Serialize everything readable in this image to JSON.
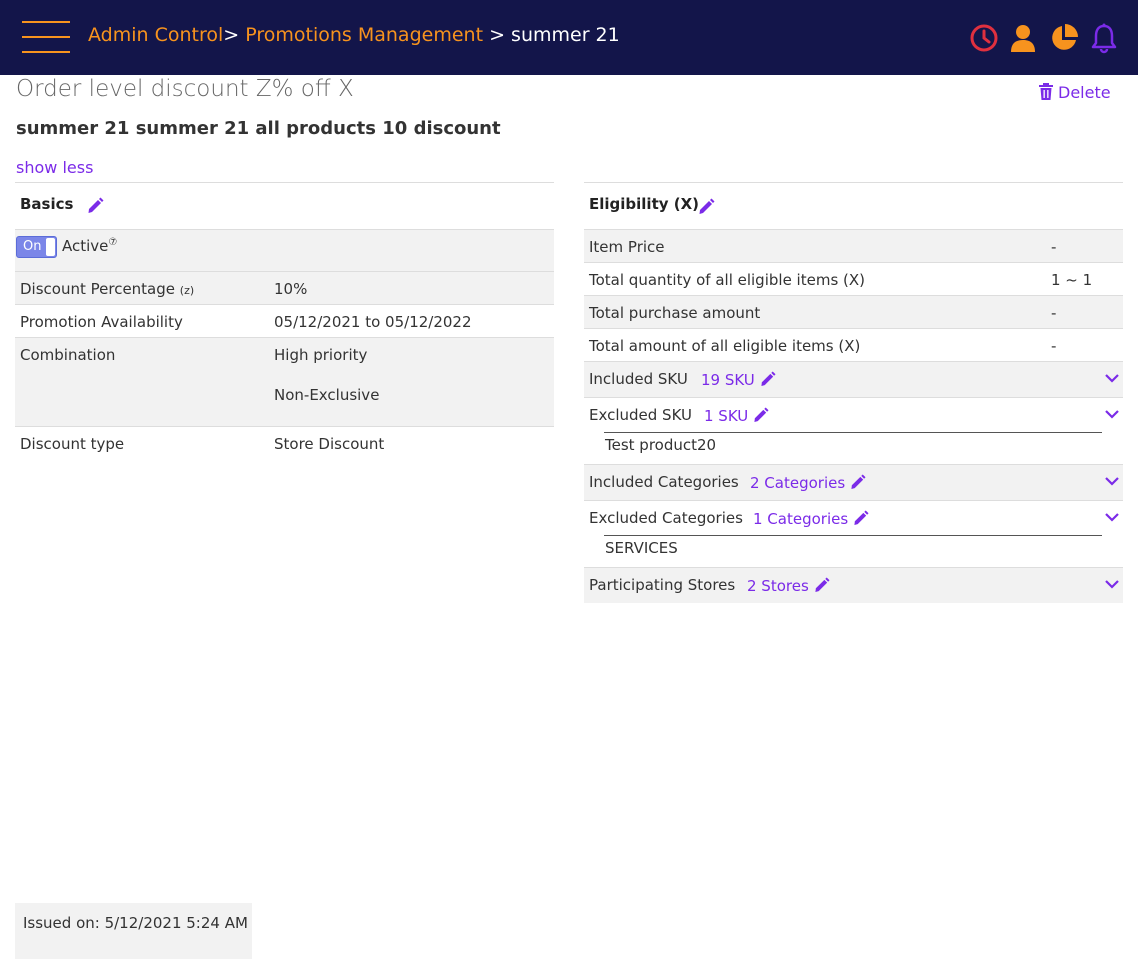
{
  "header": {
    "menu_icon": "hamburger-menu-icon",
    "breadcrumb": [
      {
        "label": "Admin Control",
        "sep": ">"
      },
      {
        "label": "Promotions Management",
        "sep": ">"
      },
      {
        "label": "summer 21"
      }
    ],
    "icons": [
      "clock-icon",
      "user-icon",
      "pie-chart-icon",
      "bell-icon"
    ],
    "colors": {
      "bar": "#13154a",
      "accent": "#f7931e",
      "clock": "#e0303f",
      "bell": "#7b2be8"
    }
  },
  "page": {
    "title": "Order level discount Z% off X",
    "subtitle": "summer 21 summer 21 all products 10 discount",
    "show_less": "show less",
    "delete_label": "Delete"
  },
  "basics": {
    "title": "Basics",
    "toggle_label": "On",
    "active_label": "Active",
    "active_help": "?",
    "rows": [
      {
        "label": "Discount Percentage",
        "label_suffix": "(z)",
        "value": "10%"
      },
      {
        "label": "Promotion Availability",
        "value": "05/12/2021 to 05/12/2022"
      },
      {
        "label": "Combination",
        "value": "High priority",
        "value2": "Non-Exclusive"
      },
      {
        "label": "Discount type",
        "value": "Store Discount"
      }
    ]
  },
  "eligibility": {
    "title": "Eligibility (X)",
    "rows": [
      {
        "label": "Item Price",
        "value": "-"
      },
      {
        "label": "Total quantity of all eligible items (X)",
        "value": "1 ~ 1"
      },
      {
        "label": "Total purchase amount",
        "value": "-"
      },
      {
        "label": "Total amount of all eligible items (X)",
        "value": "-"
      }
    ],
    "expandables": [
      {
        "label": "Included SKU",
        "link": "19 SKU"
      },
      {
        "label": "Excluded SKU",
        "link": "1 SKU",
        "items": [
          "Test product20"
        ]
      },
      {
        "label": "Included Categories",
        "link": "2 Categories"
      },
      {
        "label": "Excluded Categories",
        "link": "1 Categories",
        "items": [
          "SERVICES"
        ]
      },
      {
        "label": "Participating Stores",
        "link": "2 Stores"
      }
    ]
  },
  "footer": {
    "issued": "Issued on: 5/12/2021 5:24 AM"
  },
  "theme": {
    "link_color": "#7b2be8",
    "row_alt": "#f2f2f2"
  }
}
